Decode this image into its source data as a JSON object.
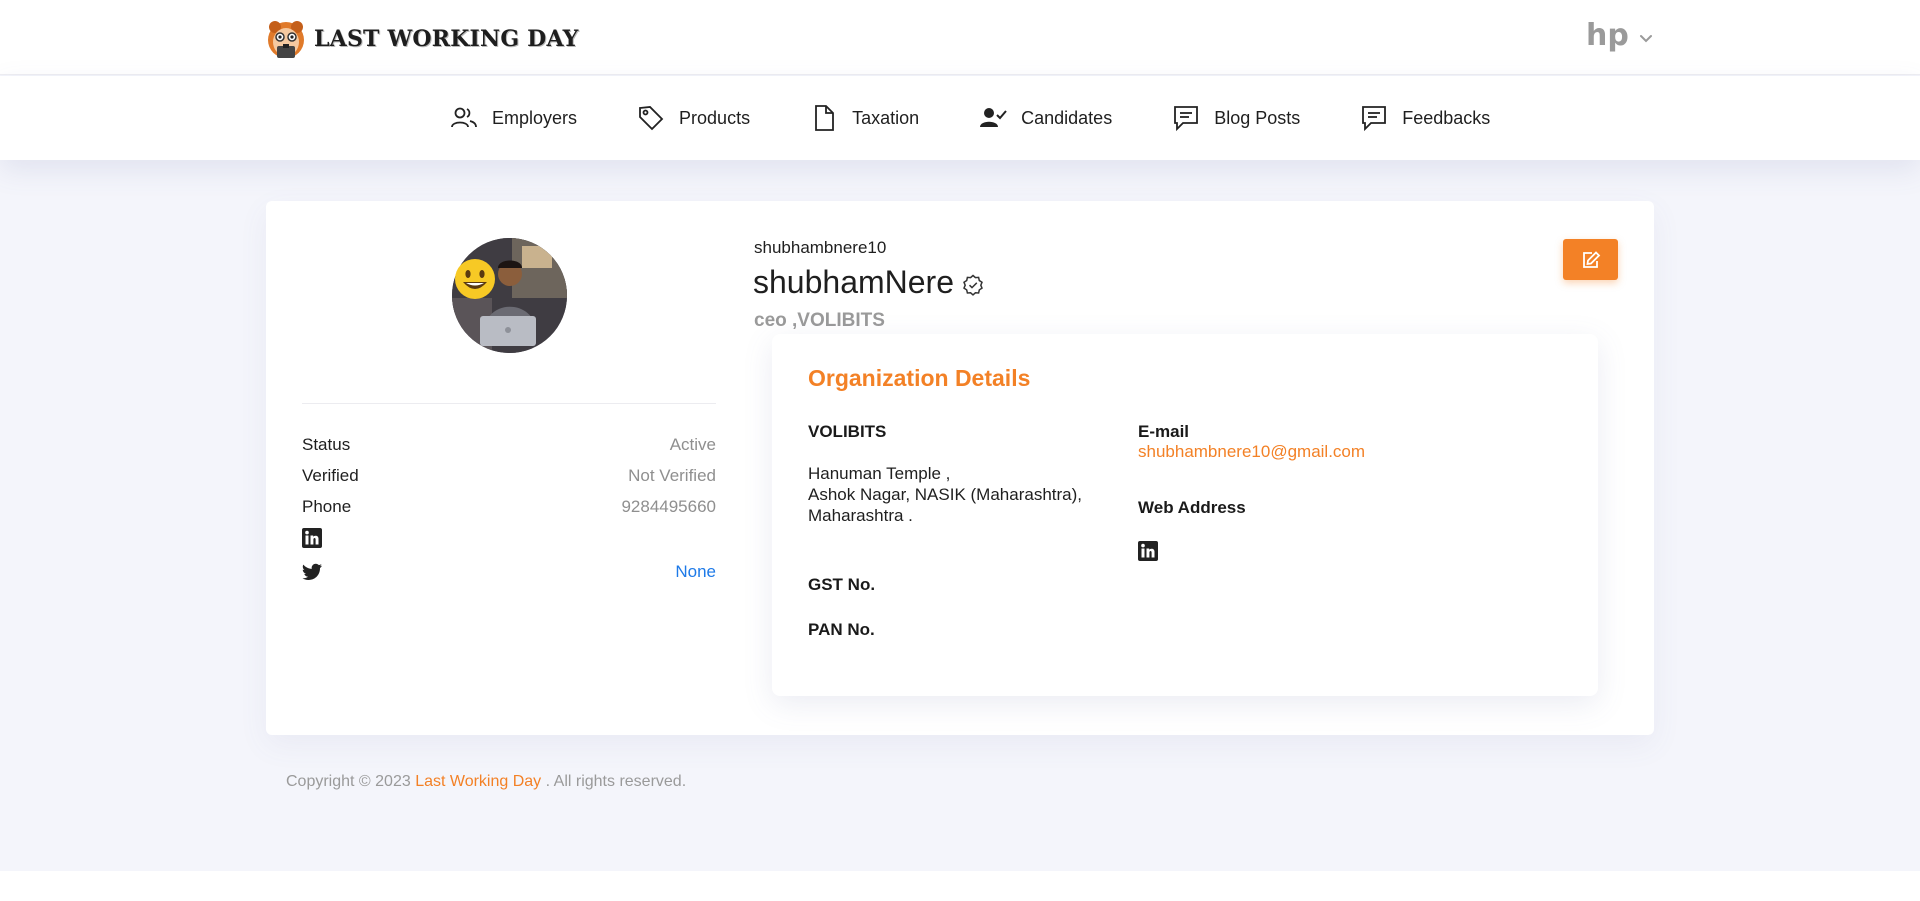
{
  "header": {
    "brand": "LAST WORKING DAY",
    "user_name": "hp"
  },
  "nav": {
    "items": [
      {
        "label": "Employers",
        "icon": "users-icon"
      },
      {
        "label": "Products",
        "icon": "tag-icon"
      },
      {
        "label": "Taxation",
        "icon": "document-icon"
      },
      {
        "label": "Candidates",
        "icon": "user-check-icon"
      },
      {
        "label": "Blog Posts",
        "icon": "message-icon"
      },
      {
        "label": "Feedbacks",
        "icon": "message-icon"
      }
    ]
  },
  "profile": {
    "username": "shubhambnere10",
    "full_name": "shubhamNere",
    "subtitle": "ceo ,VOLIBITS",
    "verified_badge_icon": "verified-badge-icon",
    "status_label": "Status",
    "status_value": "Active",
    "verified_label": "Verified",
    "verified_value": "Not Verified",
    "phone_label": "Phone",
    "phone_value": "9284495660",
    "twitter_value": "None"
  },
  "organization": {
    "title": "Organization Details",
    "name": "VOLIBITS",
    "address_line1": "Hanuman Temple ,",
    "address_line2": "Ashok Nagar, NASIK (Maharashtra),",
    "address_line3": "Maharashtra .",
    "gst_label": "GST No.",
    "pan_label": "PAN No.",
    "email_label": "E-mail",
    "email_value": "shubhambnere10@gmail.com",
    "web_label": "Web Address"
  },
  "footer": {
    "prefix": "Copyright © 2023 ",
    "link": "Last Working Day",
    "suffix": " . All rights reserved."
  },
  "colors": {
    "accent": "#f38126",
    "link_blue": "#1e7ae8",
    "page_bg": "#f4f5fb"
  }
}
